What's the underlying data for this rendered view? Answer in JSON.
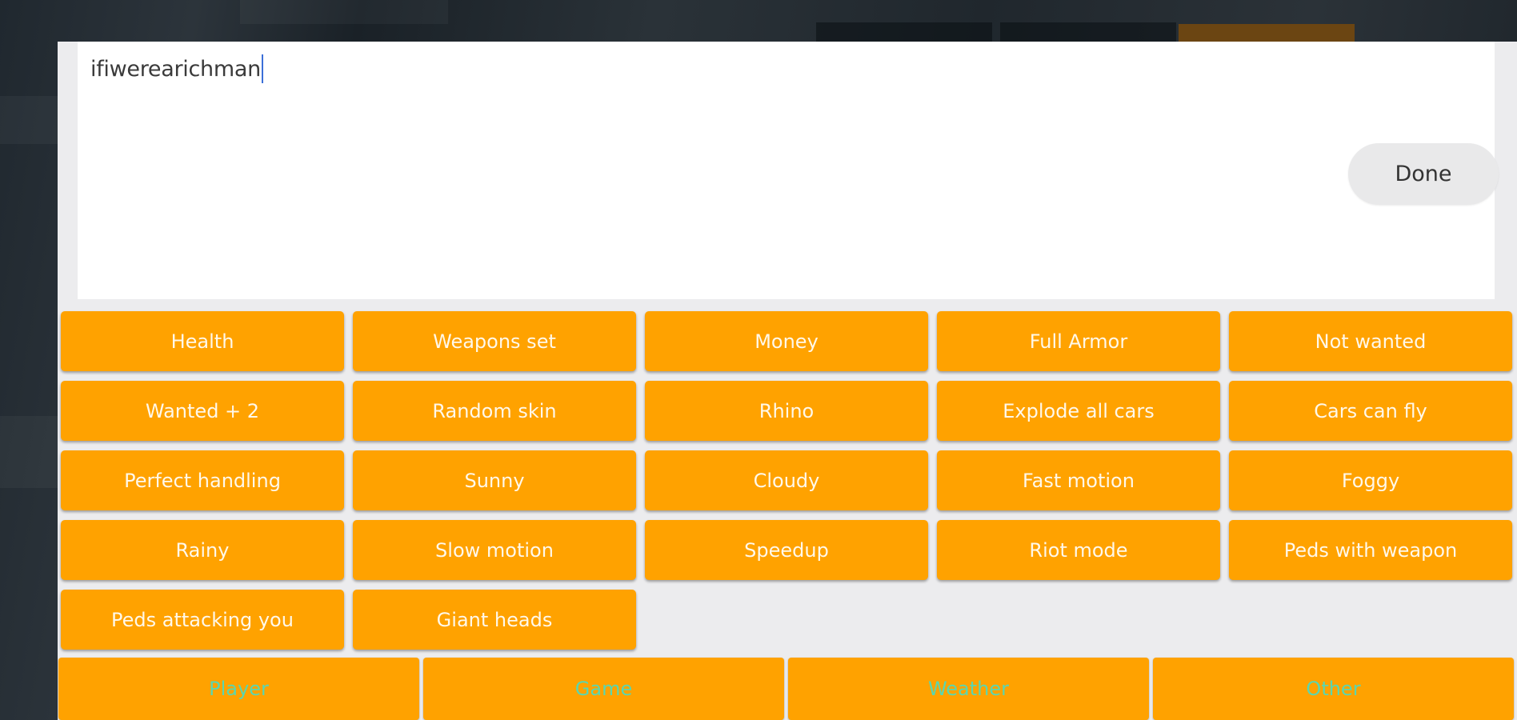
{
  "input": {
    "value": "ifiwerearichman"
  },
  "done_label": "Done",
  "cheats": [
    "Health",
    "Weapons set",
    "Money",
    "Full Armor",
    "Not wanted",
    "Wanted + 2",
    "Random skin",
    "Rhino",
    "Explode all cars",
    "Cars can fly",
    "Perfect handling",
    "Sunny",
    "Cloudy",
    "Fast motion",
    "Foggy",
    "Rainy",
    "Slow motion",
    "Speedup",
    "Riot mode",
    "Peds with weapon",
    "Peds attacking you",
    "Giant heads"
  ],
  "tabs": [
    "Player",
    "Game",
    "Weather",
    "Other"
  ],
  "colors": {
    "button": "#ffa200",
    "tab_text": "#5ad6b0",
    "panel": "#ececee",
    "caret": "#3b6fd8"
  }
}
